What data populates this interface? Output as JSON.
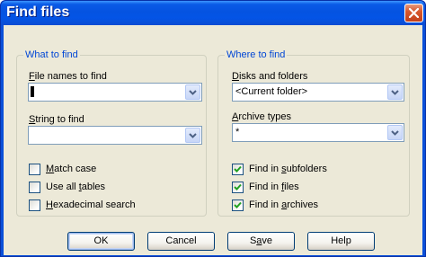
{
  "window": {
    "title": "Find files"
  },
  "what_group": {
    "label": "What to find",
    "file_names": {
      "label_pre": "",
      "label_key": "F",
      "label_post": "ile names to find",
      "value": ""
    },
    "string": {
      "label_pre": "",
      "label_key": "S",
      "label_post": "tring to find",
      "value": ""
    },
    "options": [
      {
        "pre": "",
        "key": "M",
        "post": "atch case",
        "checked": false
      },
      {
        "pre": "Use all ",
        "key": "t",
        "post": "ables",
        "checked": false
      },
      {
        "pre": "",
        "key": "H",
        "post": "exadecimal search",
        "checked": false
      }
    ]
  },
  "where_group": {
    "label": "Where to find",
    "disks": {
      "label_pre": "",
      "label_key": "D",
      "label_post": "isks and folders",
      "value": "<Current folder>"
    },
    "archive": {
      "label_pre": "",
      "label_key": "A",
      "label_post": "rchive types",
      "value": "*"
    },
    "options": [
      {
        "pre": "Find in ",
        "key": "s",
        "post": "ubfolders",
        "checked": true
      },
      {
        "pre": "Find in ",
        "key": "f",
        "post": "iles",
        "checked": true
      },
      {
        "pre": "Find in ",
        "key": "a",
        "post": "rchives",
        "checked": true
      }
    ]
  },
  "buttons": {
    "ok": "OK",
    "cancel": "Cancel",
    "save_pre": "S",
    "save_key": "a",
    "save_post": "ve",
    "help": "Help"
  }
}
